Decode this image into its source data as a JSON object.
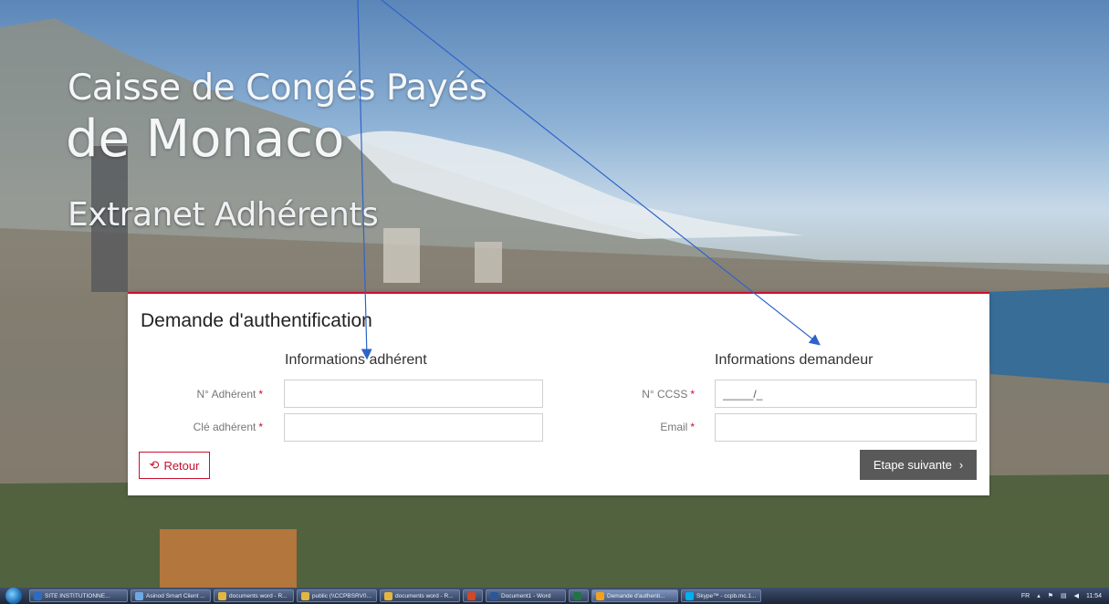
{
  "brand": {
    "line1": "Caisse de Congés Payés",
    "line2": "de Monaco",
    "line3": "Extranet Adhérents"
  },
  "form": {
    "title": "Demande d'authentification",
    "section_left": "Informations adhérent",
    "section_right": "Informations demandeur",
    "fields": {
      "adherent_number_label": "N° Adhérent",
      "adherent_key_label": "Clé adhérent",
      "ccss_label": "N° CCSS",
      "ccss_value": "_____/_",
      "email_label": "Email",
      "required_mark": "*"
    },
    "back_label": "Retour",
    "next_label": "Etape suivante",
    "accent_color": "#c8102e"
  },
  "taskbar": {
    "items": [
      "SITE INSTITUTIONNE...",
      "Asinod Smart Client ...",
      "documents word - R...",
      "public (\\\\CCPBSRV0...",
      "documents word - R...",
      "",
      "Document1 - Word",
      "",
      "Demande d'authenti...",
      "Skype™ - ccpb.mc.1..."
    ],
    "lang": "FR",
    "clock": "11:54"
  }
}
